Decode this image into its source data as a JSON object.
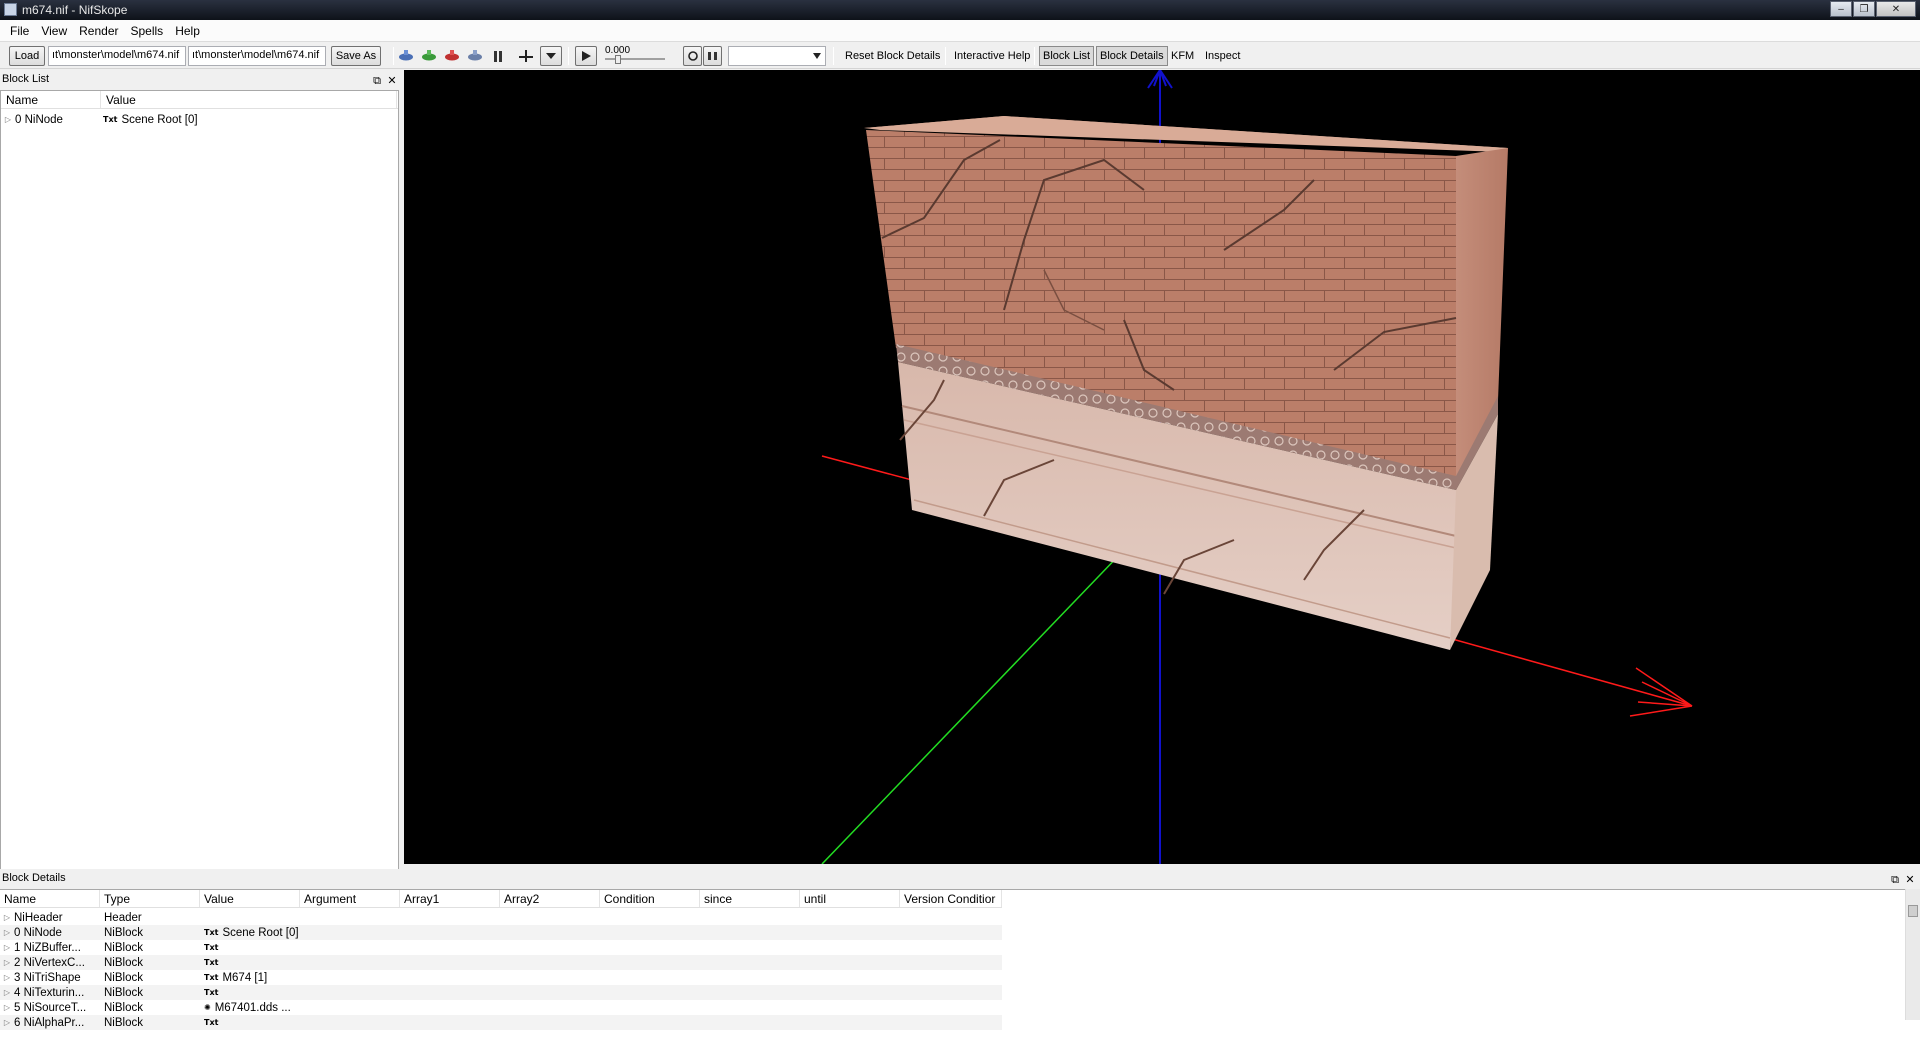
{
  "window": {
    "title": "m674.nif - NifSkope",
    "min": "–",
    "max": "❐",
    "close": "✕"
  },
  "menu": [
    "File",
    "View",
    "Render",
    "Spells",
    "Help"
  ],
  "toolbar": {
    "load": "Load",
    "load_path": "ıt\\monster\\model\\m674.nif",
    "save_path": "ıt\\monster\\model\\m674.nif",
    "save_as": "Save As",
    "time_value": "0.000",
    "reset_block_details": "Reset Block Details",
    "interactive_help": "Interactive Help",
    "block_list": "Block List",
    "block_details": "Block Details",
    "kfm": "KFM",
    "inspect": "Inspect"
  },
  "block_list": {
    "title": "Block List",
    "columns": [
      "Name",
      "Value"
    ],
    "rows": [
      {
        "name": "0 NiNode",
        "icon": "Txt",
        "value": "Scene Root [0]"
      }
    ]
  },
  "block_details": {
    "title": "Block Details",
    "columns": [
      "Name",
      "Type",
      "Value",
      "Argument",
      "Array1",
      "Array2",
      "Condition",
      "since",
      "until",
      "Version Conditior"
    ],
    "rows": [
      {
        "name": "NiHeader",
        "type": "Header",
        "icon": "",
        "value": ""
      },
      {
        "name": "0 NiNode",
        "type": "NiBlock",
        "icon": "Txt",
        "value": "Scene Root [0]"
      },
      {
        "name": "1 NiZBuffer...",
        "type": "NiBlock",
        "icon": "Txt",
        "value": ""
      },
      {
        "name": "2 NiVertexC...",
        "type": "NiBlock",
        "icon": "Txt",
        "value": ""
      },
      {
        "name": "3 NiTriShape",
        "type": "NiBlock",
        "icon": "Txt",
        "value": "M674 [1]"
      },
      {
        "name": "4 NiTexturin...",
        "type": "NiBlock",
        "icon": "Txt",
        "value": ""
      },
      {
        "name": "5 NiSourceT...",
        "type": "NiBlock",
        "icon": "✺",
        "value": "M67401.dds ..."
      },
      {
        "name": "6 NiAlphaPr...",
        "type": "NiBlock",
        "icon": "Txt",
        "value": ""
      }
    ]
  },
  "colors": {
    "x_axis": "#ff1a1a",
    "y_axis": "#22dd22",
    "z_axis": "#1111cc",
    "viewport_bg": "#000000"
  }
}
